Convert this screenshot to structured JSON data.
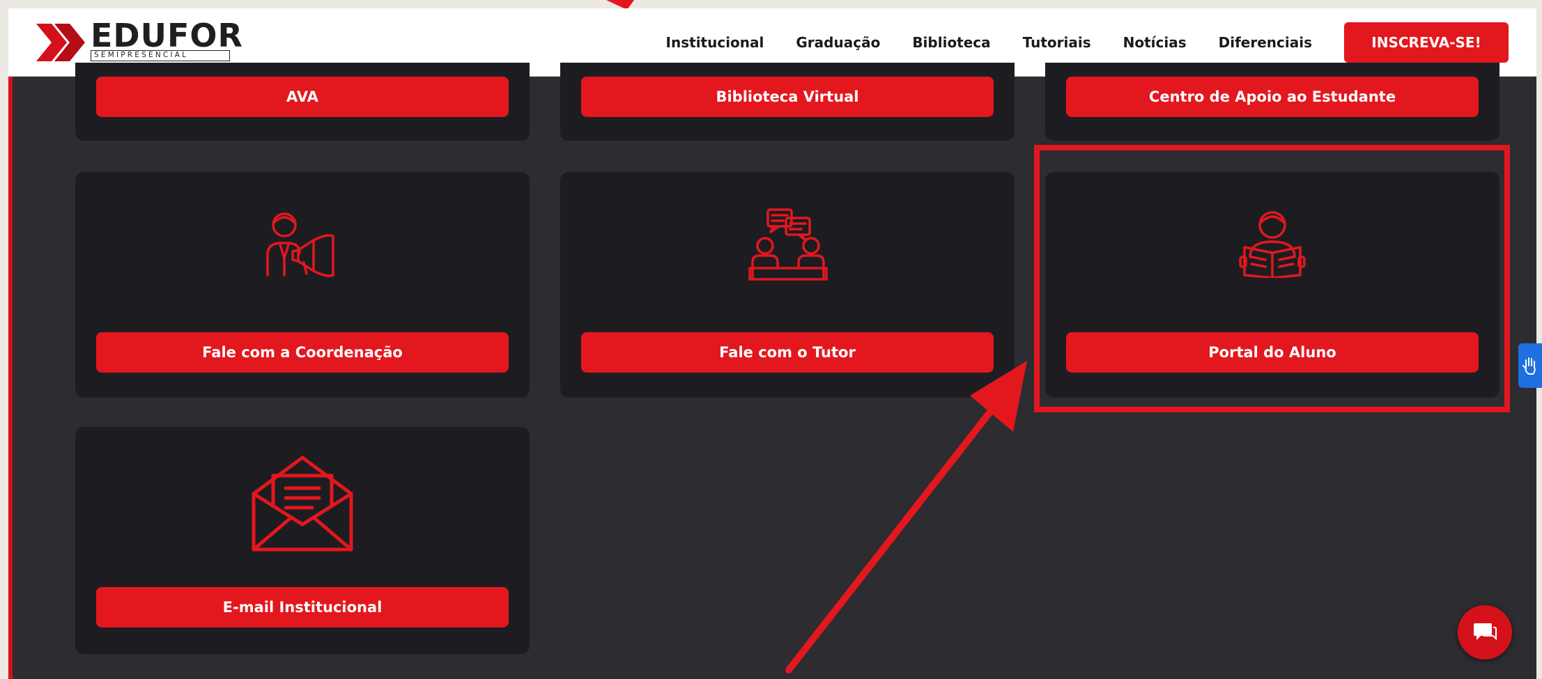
{
  "header": {
    "logo_text": "EDUFOR",
    "logo_sub": "SEMIPRESENCIAL",
    "nav": [
      "Institucional",
      "Graduação",
      "Biblioteca",
      "Tutoriais",
      "Notícias",
      "Diferenciais"
    ],
    "cta": "INSCREVA-SE!"
  },
  "cards": {
    "ava": "AVA",
    "biblioteca": "Biblioteca Virtual",
    "apoio": "Centro de Apoio ao Estudante",
    "coordenacao": "Fale com a Coordenação",
    "tutor": "Fale com o Tutor",
    "portal": "Portal do Aluno",
    "email": "E-mail Institucional"
  },
  "colors": {
    "accent": "#e3171e",
    "panel": "#2c2c31",
    "card": "#1d1d21",
    "accessibility": "#1f6fe0"
  },
  "icons": {
    "coordenacao": "megaphone-person-icon",
    "tutor": "meeting-chat-icon",
    "portal": "student-reading-icon",
    "email": "open-envelope-icon",
    "accessibility": "sign-language-hand-icon",
    "chat": "chat-bubble-icon"
  }
}
